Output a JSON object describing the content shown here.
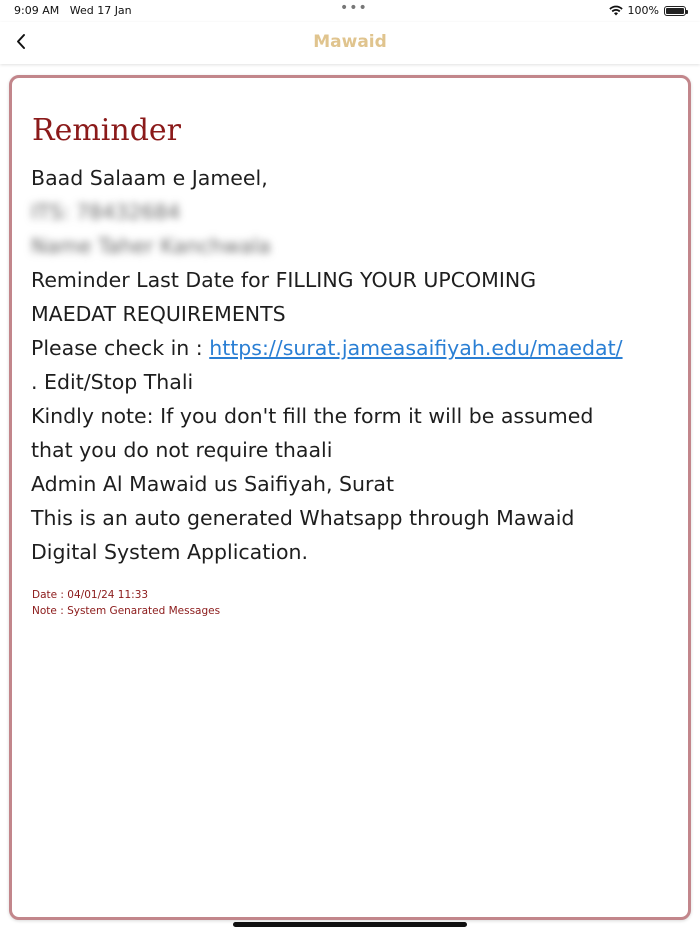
{
  "status_bar": {
    "time": "9:09 AM",
    "date": "Wed 17 Jan",
    "battery": "100%"
  },
  "nav": {
    "title": "Mawaid",
    "back_icon": "chevron-left-icon",
    "title_color": "#e0c48e"
  },
  "message": {
    "heading": "Reminder",
    "greeting": "Baad Salaam  e Jameel,",
    "redacted_line_1": "ITS: 78432684",
    "redacted_line_2": "Name Taher Kanchwala",
    "line_reminder_1": " Reminder Last Date  for FILLING YOUR UPCOMING",
    "line_reminder_2": "MAEDAT REQUIREMENTS",
    "check_prefix": " Please check in : ",
    "check_link": "https://surat.jameasaifiyah.edu/maedat/",
    "edit_stop": ". Edit/Stop Thali",
    "note_1": "Kindly note: If you don't fill the form it will be assumed",
    "note_2": "that you do not require thaali",
    "admin": "Admin Al Mawaid us Saifiyah, Surat",
    "auto_1": "This is an auto generated Whatsapp through Mawaid",
    "auto_2": "Digital System Application.",
    "date": "Date : 04/01/24 11:33",
    "note": "Note : System Genarated Messages"
  },
  "colors": {
    "heading": "#8b1a1a",
    "card_border": "#c2868b",
    "link": "#2a7fd4"
  }
}
